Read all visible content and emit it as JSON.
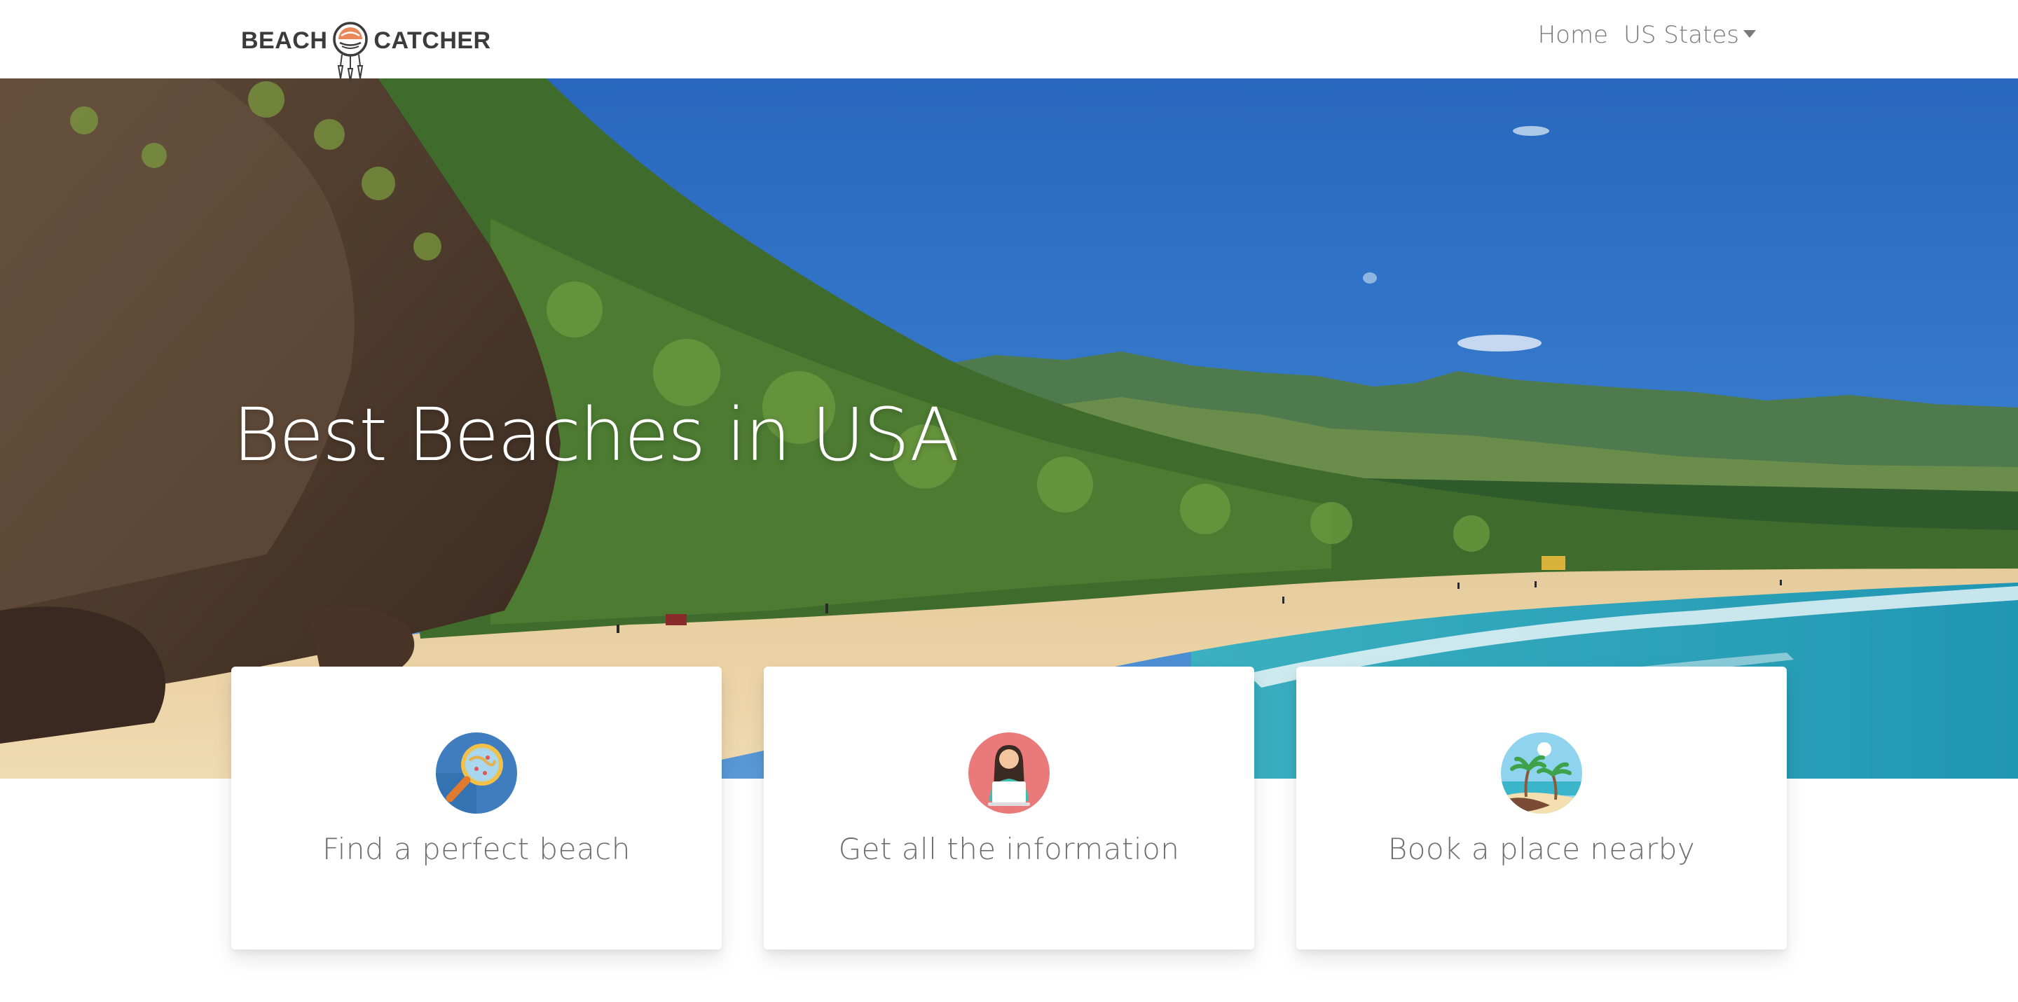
{
  "brand": {
    "word_left": "BEACH",
    "word_right": "CATCHER",
    "logo_icon": "dreamcatcher-sun-icon"
  },
  "nav": {
    "items": [
      {
        "label": "Home"
      },
      {
        "label": "US States",
        "has_dropdown": true
      }
    ]
  },
  "hero": {
    "title": "Best Beaches in USA",
    "background": "beach-cliff-ocean-photo"
  },
  "cards": [
    {
      "label": "Find a perfect beach",
      "icon": "magnifier-map-icon"
    },
    {
      "label": "Get all the information",
      "icon": "woman-laptop-icon"
    },
    {
      "label": "Book a place nearby",
      "icon": "palm-island-icon"
    }
  ],
  "colors": {
    "brand_text": "#3b3b3b",
    "nav_text": "#7a7a7a",
    "card_text": "#6e6e6e",
    "sky": "#2f73c4",
    "sand": "#e8cfa3",
    "sea": "#2ea3b8"
  }
}
